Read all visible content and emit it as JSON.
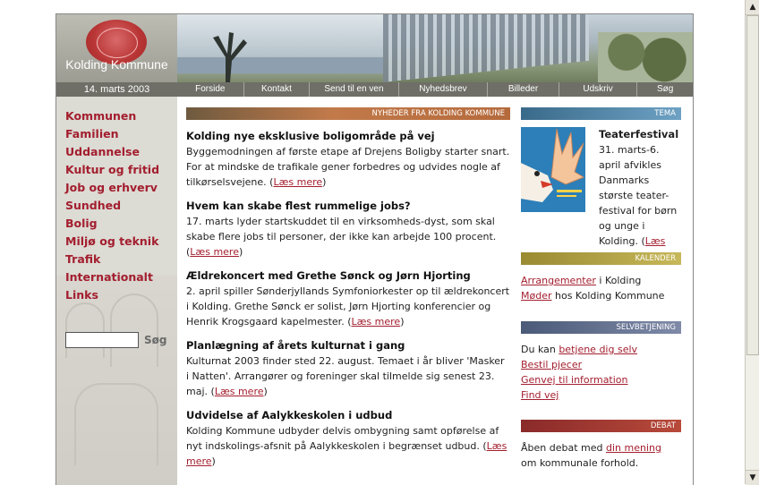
{
  "header": {
    "org_name": "Kolding Kommune",
    "date": "14. marts 2003",
    "nav": [
      "Forside",
      "Kontakt",
      "Send til en ven",
      "Nyhedsbrev",
      "Billeder",
      "Udskriv",
      "Søg"
    ]
  },
  "sidebar": {
    "items": [
      "Kommunen",
      "Familien",
      "Uddannelse",
      "Kultur og fritid",
      "Job og erhverv",
      "Sundhed",
      "Bolig",
      "Miljø og teknik",
      "Trafik",
      "Internationalt",
      "Links"
    ],
    "search_button": "Søg"
  },
  "news": {
    "heading": "NYHEDER FRA KOLDING KOMMUNE",
    "more_label": "Læs mere",
    "items": [
      {
        "title": "Kolding nye eksklusive boligområde på vej",
        "body": "Byggemodningen af første etape af Drejens Boligby starter snart. For at mindske de trafikale gener forbedres og udvides nogle af tilkørselsvejene."
      },
      {
        "title": "Hvem kan skabe flest rummelige jobs?",
        "body": "17. marts lyder startskuddet til en virksomheds-dyst, som skal skabe flere jobs til personer, der ikke kan arbejde 100 procent."
      },
      {
        "title": "Ældrekoncert med Grethe Sønck og Jørn Hjorting",
        "body": "2. april spiller Sønderjyllands Symfoniorkester op til ældrekoncert i Kolding. Grethe Sønck er solist, Jørn Hjorting konferencier og Henrik Krogsgaard kapelmester."
      },
      {
        "title": "Planlægning af årets kulturnat i gang",
        "body": "Kulturnat 2003 finder sted 22. august. Temaet i år bliver 'Masker i Natten'. Arrangører og foreninger skal tilmelde sig senest 23. maj."
      },
      {
        "title": "Udvidelse af Aalykkeskolen i udbud",
        "body": "Kolding Kommune udbyder delvis ombygning samt opførelse af nyt indskolings-afsnit på Aalykkeskolen i begrænset udbud."
      }
    ]
  },
  "tema": {
    "heading": "TEMA",
    "title": "Teaterfestival",
    "body": "31. marts-6. april afvikles Danmarks største teater-festival for børn og unge i Kolding.",
    "more_label": "Læs mere"
  },
  "kalender": {
    "heading": "KALENDER",
    "link1": "Arrangementer",
    "text1": " i Kolding",
    "link2": "Møder",
    "text2": " hos Kolding Kommune"
  },
  "selvbetjening": {
    "heading": "SELVBETJENING",
    "intro": "Du kan ",
    "intro_link": "betjene dig selv",
    "links": [
      "Bestil pjecer",
      "Genvej til information",
      "Find vej"
    ]
  },
  "debat": {
    "heading": "DEBAT",
    "text1": "Åben debat med ",
    "link": "din mening",
    "text2": "om kommunale forhold."
  },
  "scrollbar": {
    "up": "▲",
    "down": "▼"
  }
}
